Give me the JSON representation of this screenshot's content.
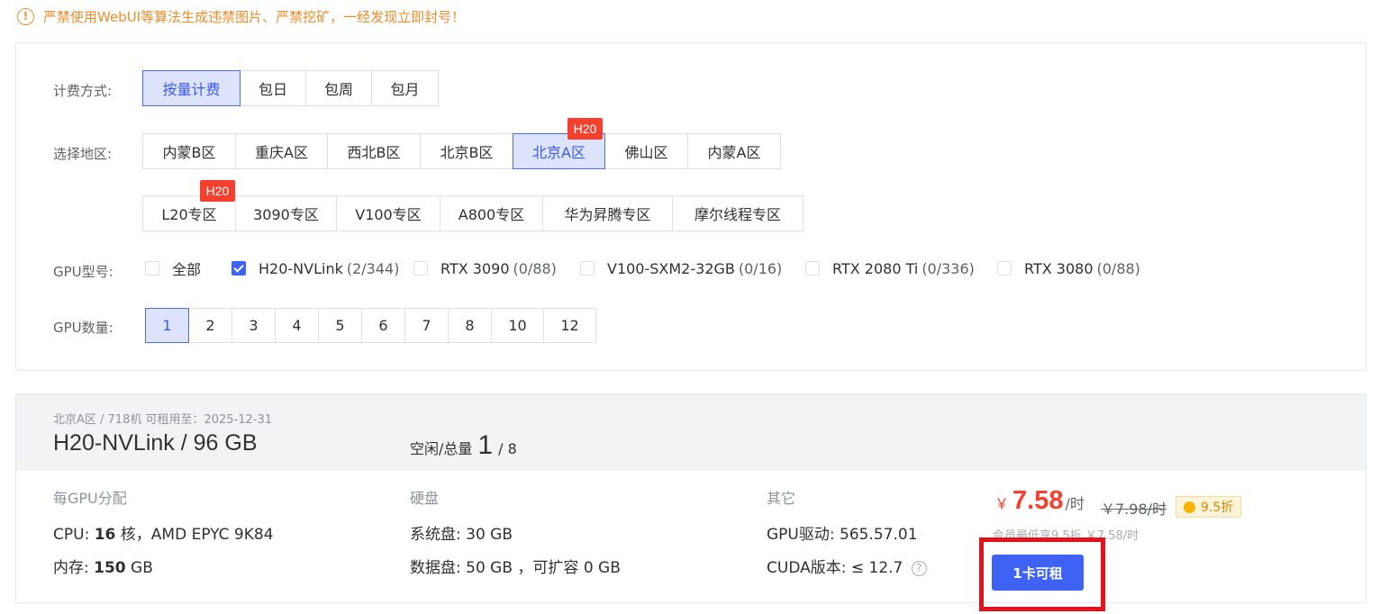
{
  "notice": {
    "icon": "warning-circle-icon",
    "text": "严禁使用WebUI等算法生成违禁图片、严禁挖矿，一经发现立即封号！"
  },
  "filters": {
    "billing": {
      "label": "计费方式:",
      "options": [
        "按量计费",
        "包日",
        "包周",
        "包月"
      ],
      "selected": "按量计费"
    },
    "region": {
      "label": "选择地区:",
      "row1": [
        "内蒙B区",
        "重庆A区",
        "西北B区",
        "北京B区",
        "北京A区",
        "佛山区",
        "内蒙A区"
      ],
      "row2": [
        "L20专区",
        "3090专区",
        "V100专区",
        "A800专区",
        "华为昇腾专区",
        "摩尔线程专区"
      ],
      "selected": "北京A区",
      "badge": "H20"
    },
    "gpu_type": {
      "label": "GPU型号:",
      "options": [
        {
          "name": "全部",
          "count": "",
          "checked": false
        },
        {
          "name": "H20-NVLink",
          "count": "(2/344)",
          "checked": true
        },
        {
          "name": "RTX 3090",
          "count": "(0/88)",
          "checked": false
        },
        {
          "name": "V100-SXM2-32GB",
          "count": "(0/16)",
          "checked": false
        },
        {
          "name": "RTX 2080 Ti",
          "count": "(0/336)",
          "checked": false
        },
        {
          "name": "RTX 3080",
          "count": "(0/88)",
          "checked": false
        }
      ]
    },
    "gpu_count": {
      "label": "GPU数量:",
      "options": [
        "1",
        "2",
        "3",
        "4",
        "5",
        "6",
        "7",
        "8",
        "10",
        "12"
      ],
      "selected": "1"
    }
  },
  "result": {
    "meta": "北京A区 / 718机   可租用至：2025-12-31",
    "title": "H20-NVLink / 96 GB",
    "idle_label": "空闲/总量",
    "idle": "1",
    "total": "/ 8",
    "per_gpu": {
      "title": "每GPU分配",
      "cpu_label": "CPU:",
      "cpu_cores": "16",
      "cpu_rest": "核，AMD EPYC 9K84",
      "mem_label": "内存:",
      "mem_value": "150",
      "mem_unit": "GB"
    },
    "disk": {
      "title": "硬盘",
      "sys_label": "系统盘:",
      "sys_value": "30 GB",
      "data_label": "数据盘:",
      "data_value": "50 GB ，可扩容 0 GB"
    },
    "other": {
      "title": "其它",
      "driver_label": "GPU驱动:",
      "driver_value": "565.57.01",
      "cuda_label": "CUDA版本:",
      "cuda_value": "≤ 12.7",
      "help": "?"
    },
    "price": {
      "currency": "￥",
      "value": "7.58",
      "unit": "/时",
      "original": "￥7.98/时",
      "discount": "9.5折",
      "member_note": "会员最低享9.5折 ￥7.58/时"
    },
    "rent_button": "1卡可租"
  },
  "colors": {
    "accent": "#3e63f4",
    "warning": "#f08c2a",
    "price": "#f5402f",
    "highlight": "#e2131a"
  }
}
